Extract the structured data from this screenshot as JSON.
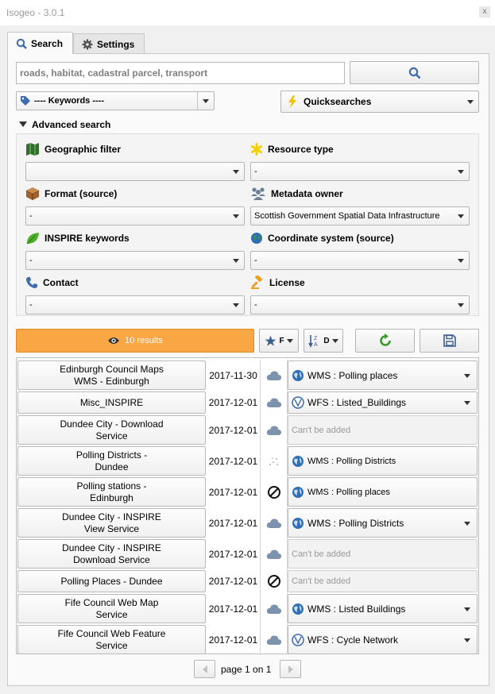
{
  "window": {
    "title": "Isogeo - 3.0.1",
    "close_label": "x"
  },
  "tabs": [
    {
      "label": "Search",
      "active": true
    },
    {
      "label": "Settings",
      "active": false
    }
  ],
  "search": {
    "placeholder": "roads, habitat, cadastral parcel, transport",
    "value": ""
  },
  "keywords_combo": {
    "value": "---- Keywords ----"
  },
  "quicksearches_combo": {
    "value": "Quicksearches"
  },
  "advanced": {
    "header": "Advanced search",
    "filters": [
      {
        "label": "Geographic filter",
        "value": "",
        "icon": "map-icon"
      },
      {
        "label": "Resource type",
        "value": "-",
        "icon": "asterisk-icon"
      },
      {
        "label": "Format (source)",
        "value": "-",
        "icon": "box-icon"
      },
      {
        "label": "Metadata owner",
        "value": "Scottish Government Spatial Data Infrastructure",
        "icon": "group-icon"
      },
      {
        "label": "INSPIRE keywords",
        "value": "-",
        "icon": "leaf-icon"
      },
      {
        "label": "Coordinate system (source)",
        "value": "-",
        "icon": "globe-icon"
      },
      {
        "label": "Contact",
        "value": "-",
        "icon": "phone-icon"
      },
      {
        "label": "License",
        "value": "-",
        "icon": "gavel-icon"
      }
    ]
  },
  "toolbar": {
    "results_label": "10 results",
    "sort_owner_letter": "F",
    "sort_order_letter": "D"
  },
  "results": [
    {
      "title": "Edinburgh Council Maps\nWMS - Edinburgh",
      "date": "2017-11-30",
      "icon": "cloud",
      "service": "WMS : Polling places",
      "kind": "wms",
      "dropdown": true
    },
    {
      "title": "Misc_INSPIRE",
      "date": "2017-12-01",
      "icon": "cloud",
      "service": "WFS : Listed_Buildings",
      "kind": "wfs",
      "dropdown": true
    },
    {
      "title": "Dundee City - Download\nService",
      "date": "2017-12-01",
      "icon": "cloud",
      "service": "Can't be added",
      "kind": "none",
      "dropdown": false
    },
    {
      "title": "Polling Districts -\nDundee",
      "date": "2017-12-01",
      "icon": "dots",
      "service": "WMS : Polling Districts",
      "kind": "wms-small",
      "dropdown": false
    },
    {
      "title": "Polling stations -\nEdinburgh",
      "date": "2017-12-01",
      "icon": "ban",
      "service": "WMS : Polling places",
      "kind": "wms-small",
      "dropdown": false
    },
    {
      "title": "Dundee City - INSPIRE\nView Service",
      "date": "2017-12-01",
      "icon": "cloud",
      "service": "WMS : Polling Districts",
      "kind": "wms",
      "dropdown": true
    },
    {
      "title": "Dundee City - INSPIRE\nDownload Service",
      "date": "2017-12-01",
      "icon": "cloud",
      "service": "Can't be added",
      "kind": "none",
      "dropdown": false
    },
    {
      "title": "Polling Places - Dundee",
      "date": "2017-12-01",
      "icon": "ban",
      "service": "Can't be added",
      "kind": "none",
      "dropdown": false
    },
    {
      "title": "Fife Council Web Map\nService",
      "date": "2017-12-01",
      "icon": "cloud",
      "service": "WMS : Listed Buildings",
      "kind": "wms",
      "dropdown": true
    },
    {
      "title": "Fife Council Web Feature\nService",
      "date": "2017-12-01",
      "icon": "cloud",
      "service": "WFS : Cycle Network",
      "kind": "wfs",
      "dropdown": true
    }
  ],
  "pager": {
    "label": "page 1 on 1"
  },
  "colors": {
    "accent_orange": "#f9a645",
    "refresh_green": "#3a9a2a",
    "cloud_blue": "#7d93ad"
  }
}
